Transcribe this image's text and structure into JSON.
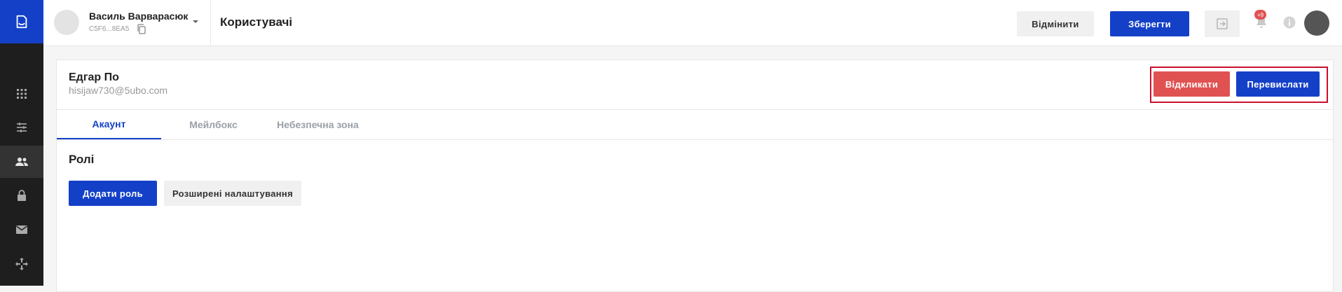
{
  "sidebar": {
    "logo_icon": "document-logo-icon",
    "items": [
      {
        "name": "apps",
        "icon": "grid-icon"
      },
      {
        "name": "settings",
        "icon": "sliders-icon"
      },
      {
        "name": "users",
        "icon": "people-icon",
        "active": true
      },
      {
        "name": "security",
        "icon": "lock-icon"
      },
      {
        "name": "mail",
        "icon": "mail-icon"
      },
      {
        "name": "integrations",
        "icon": "move-icon"
      }
    ]
  },
  "topbar": {
    "user_name": "Василь Варварасюк",
    "user_id": "C5F6...8EA5",
    "page_title": "Користувачі",
    "cancel_label": "Відмінити",
    "save_label": "Зберегти",
    "notification_count": "+9"
  },
  "contact": {
    "name": "Едгар По",
    "email": "hisijaw730@5ubo.com",
    "revoke_label": "Відкликати",
    "resend_label": "Перевислати"
  },
  "tabs": [
    {
      "label": "Акаунт",
      "active": true
    },
    {
      "label": "Мейлбокс",
      "active": false
    },
    {
      "label": "Небезпечна зона",
      "active": false
    }
  ],
  "roles": {
    "title": "Ролі",
    "add_role_label": "Додати роль",
    "advanced_label": "Розширені налаштування"
  },
  "colors": {
    "primary": "#1440c8",
    "danger": "#e05252",
    "highlight_border": "#c8102e",
    "sidebar_bg": "#1e1e1e"
  }
}
